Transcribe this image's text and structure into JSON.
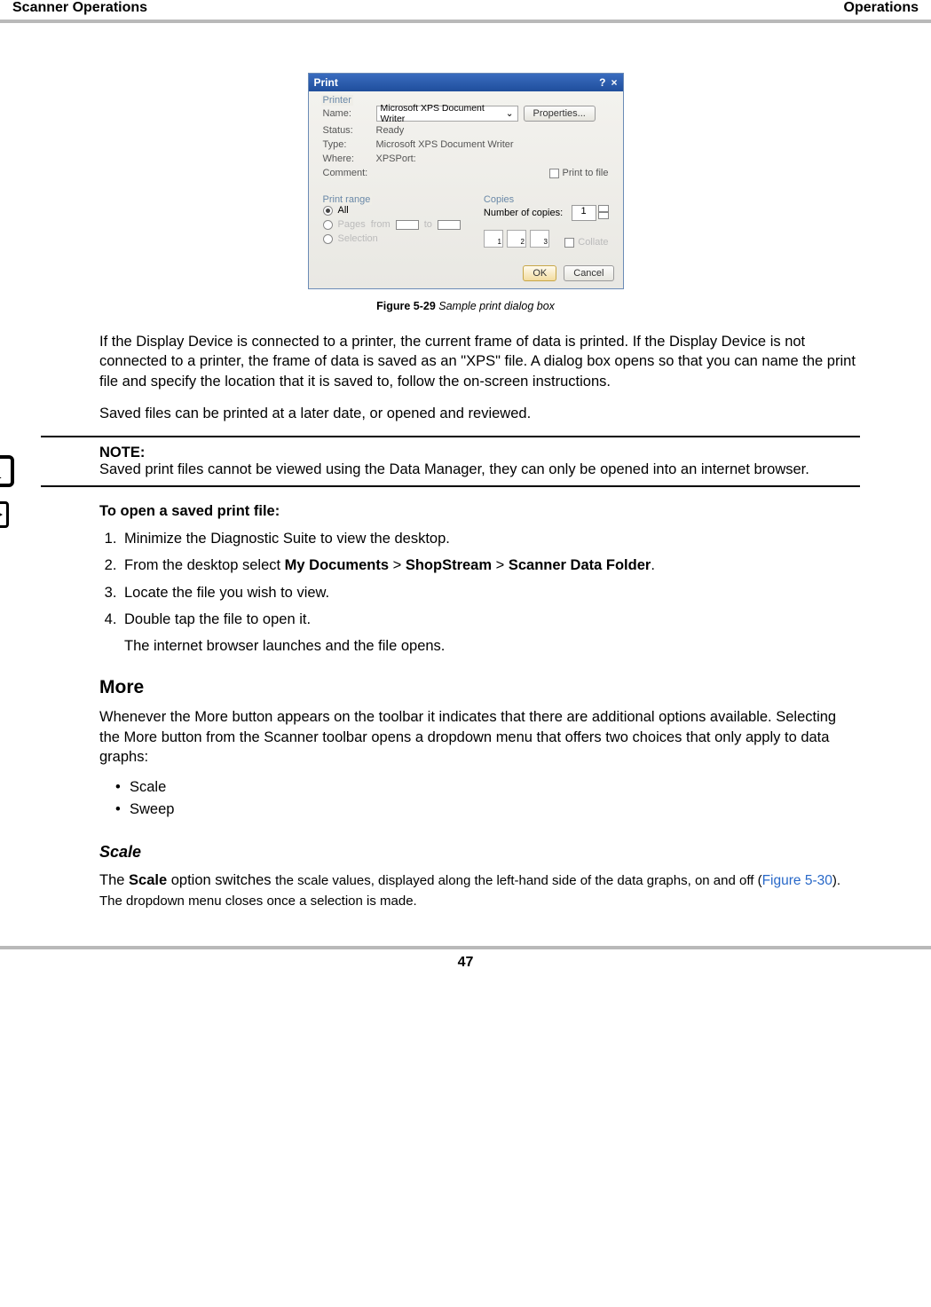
{
  "header": {
    "left": "Scanner Operations",
    "right": "Operations"
  },
  "dialog": {
    "title": "Print",
    "help": "?",
    "close": "×",
    "printer_legend": "Printer",
    "name_label": "Name:",
    "name_value": "Microsoft XPS Document Writer",
    "properties_btn": "Properties...",
    "status_label": "Status:",
    "status_value": "Ready",
    "type_label": "Type:",
    "type_value": "Microsoft XPS Document Writer",
    "where_label": "Where:",
    "where_value": "XPSPort:",
    "comment_label": "Comment:",
    "print_to_file": "Print to file",
    "range_legend": "Print range",
    "all": "All",
    "pages": "Pages",
    "from": "from",
    "to": "to",
    "selection": "Selection",
    "copies_legend": "Copies",
    "num_copies": "Number of copies:",
    "num_copies_val": "1",
    "collate": "Collate",
    "c1": "1",
    "c2": "2",
    "c3": "3",
    "ok": "OK",
    "cancel": "Cancel"
  },
  "caption_fig": "Figure 5-29 ",
  "caption_text": "Sample print dialog box",
  "para1": "If the Display Device is connected to a printer, the current frame of data is printed. If the Display Device is not connected to a printer, the frame of data is saved as an \"XPS\" file. A dialog box opens so that you can name the print file and specify the location that it is saved to, follow the on-screen instructions.",
  "para2": "Saved files can be printed at a later date, or opened and reviewed.",
  "note_title": "NOTE:",
  "note_body": "Saved print files cannot be viewed using the Data Manager, they can only be opened into an internet browser.",
  "proc_title": "To open a saved print file:",
  "steps": {
    "s1": "Minimize the Diagnostic Suite to view the desktop.",
    "s2a": "From the desktop select ",
    "s2b1": "My Documents",
    "s2s1": " > ",
    "s2b2": "ShopStream",
    "s2s2": " > ",
    "s2b3": "Scanner Data Folder",
    "s2end": ".",
    "s3": "Locate the file you wish to view.",
    "s4": "Double tap the file to open it.",
    "s4sub": "The internet browser launches and the file opens."
  },
  "more_heading": "More",
  "more_para": "Whenever the More button appears on the toolbar it indicates that there are additional options available. Selecting the More button from the Scanner toolbar opens a dropdown menu that offers two choices that only apply to data graphs:",
  "bullets": {
    "b1": "Scale",
    "b2": "Sweep"
  },
  "scale_heading": "Scale",
  "scale_a": "The ",
  "scale_b": "Scale",
  "scale_c": " option switches ",
  "scale_d": "the scale values, displayed along the left-hand side of the data graphs, on and off (",
  "scale_ref": "Figure 5-30",
  "scale_e": "). The dropdown menu closes once a selection is made.",
  "page_number": "47"
}
